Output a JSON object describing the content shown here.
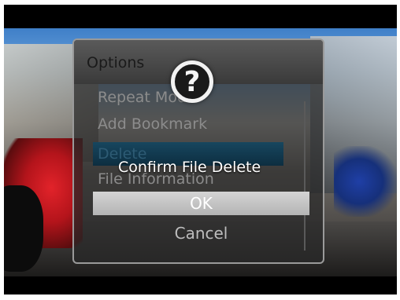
{
  "options_menu": {
    "title": "Options",
    "items": [
      {
        "label": "Repeat Mode",
        "selected": false
      },
      {
        "label": "Add Bookmark",
        "selected": false
      },
      {
        "label": "Delete",
        "selected": true
      },
      {
        "label": "File Information",
        "selected": false
      }
    ]
  },
  "confirm_dialog": {
    "icon": "question-icon",
    "icon_glyph": "?",
    "title": "Confirm File Delete",
    "ok_label": "OK",
    "cancel_label": "Cancel",
    "focused_button": "OK"
  },
  "colors": {
    "highlight": "#0d2e40",
    "ok_button": "#c4c4c4",
    "panel": "#3a3a3a"
  }
}
